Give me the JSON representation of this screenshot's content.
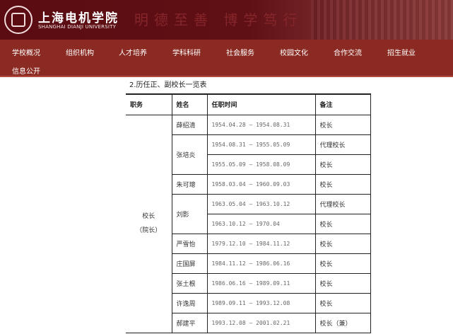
{
  "header": {
    "logo_cn": "上海电机学院",
    "logo_en": "SHANGHAI DIANJI UNIVERSITY",
    "motto": "明德至善 博学笃行"
  },
  "nav": [
    "学校概况",
    "组织机构",
    "人才培养",
    "学科科研",
    "社会服务",
    "校园文化",
    "合作交流",
    "招生就业",
    "信息公开"
  ],
  "content": {
    "title": "2.历任正、副校长一览表",
    "headers": [
      "职务",
      "姓名",
      "任职时间",
      "备注"
    ],
    "position_line1": "校长",
    "position_line2": "（院长）",
    "rows": [
      {
        "name": "薛绍清",
        "time": "1954.04.28 — 1954.08.31",
        "note": "校长"
      },
      {
        "name": "张培炎",
        "time": "1954.08.31 — 1955.05.09",
        "note": "代理校长"
      },
      {
        "name": "",
        "time": "1955.05.09 — 1958.08.09",
        "note": "校长"
      },
      {
        "name": "朱可璁",
        "time": "1958.03.04 — 1960.09.03",
        "note": "校长"
      },
      {
        "name": "刘影",
        "time": "1963.05.04 — 1963.10.12",
        "note": "代理校长"
      },
      {
        "name": "",
        "time": "1963.10.12 — 1970.04",
        "note": "校长"
      },
      {
        "name": "严雪怡",
        "time": "1979.12.10 — 1984.11.12",
        "note": "校长"
      },
      {
        "name": "庄国屏",
        "time": "1984.11.12 — 1986.06.16",
        "note": "校长"
      },
      {
        "name": "张土根",
        "time": "1986.06.16 — 1989.09.11",
        "note": "校长"
      },
      {
        "name": "许逸周",
        "time": "1989.09.11 — 1993.12.08",
        "note": "校长"
      },
      {
        "name": "郝建平",
        "time": "1993.12.08 — 2001.02.21",
        "note": "校长（兼）"
      }
    ]
  }
}
